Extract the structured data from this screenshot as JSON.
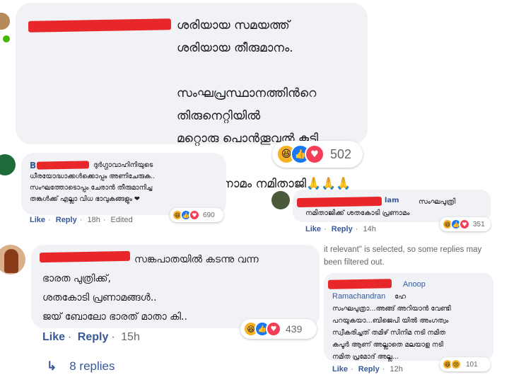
{
  "colors": {
    "link": "#385898",
    "bubble": "#f0f2f5",
    "redact": "#e8272b",
    "like": "#1877f2",
    "love": "#f33e58",
    "haha": "#f7b125",
    "online": "#44b700"
  },
  "c1": {
    "lines": "ശരിയായ സമയത്ത്\nശരിയായ തീരുമാനം.\n\nസംഘപ്രസ്ഥാനത്തിൻറെ തിരുനെറ്റിയിൽ\nമറ്റൊരു പൊൻതൂവൽ കൂടി.\n\nധ്വജ പ്രണാമം നമിതാജി🙏🙏🙏",
    "reaction_count": "502",
    "icons": [
      "haha-icon",
      "like-icon",
      "love-icon"
    ]
  },
  "c2": {
    "name_visible": "B",
    "text": "ദുർഗ്ഗാവാഹിനിയുടെ\nധീരയോദ്ധാക്കൾക്കൊപ്പം അണിചേരുക..\nസംഘത്തോടൊപ്പം ചേരാൻ തീരുമാനിച്ച\nതങ്കൾക്ക് എല്ലാ വിധ ഭാവുകങ്ങളും ❤",
    "like": "Like",
    "reply": "Reply",
    "time": "18h",
    "edited": "Edited",
    "reaction_count": "690"
  },
  "c3": {
    "name_suffix": "lam",
    "text": "സംഘപുത്രി\nനമിതാജിക്ക് ശതകോടി പ്രണാമം",
    "like": "Like",
    "reply": "Reply",
    "time": "14h",
    "reaction_count": "351"
  },
  "c4": {
    "text": "സങ്കപാതയിൽ കടന്നു വന്ന\nഭാരത പുത്രിക്ക്,\nശതകോടി പ്രണാമങ്ങൾ..\nജയ് ബോലോ ഭാരത് മാതാ കി..",
    "like": "Like",
    "reply": "Reply",
    "time": "15h",
    "reaction_count": "439",
    "replies": "8 replies"
  },
  "filter_notice": "it relevant\" is selected, so some replies may\nbeen filtered out.",
  "c5": {
    "name": "Anoop\nRamachandran",
    "text": "ഹേ\nസംഘപുത്രാ...അങ്ങ് അറിയാൻ വേണ്ടി\nപറയുകയാ...ബിജെപി യിൽ അംഗത്വം\nസ്വീകരിച്ചത് തമിഴ് സിനിമ നടി നമിത\nകപൂർ ആണ് അല്ലാതെ മലയാള നടി\nനമിത പ്രമോദ് അല്ല...",
    "like": "Like",
    "reply": "Reply",
    "time": "12h",
    "reaction_count": "101"
  }
}
